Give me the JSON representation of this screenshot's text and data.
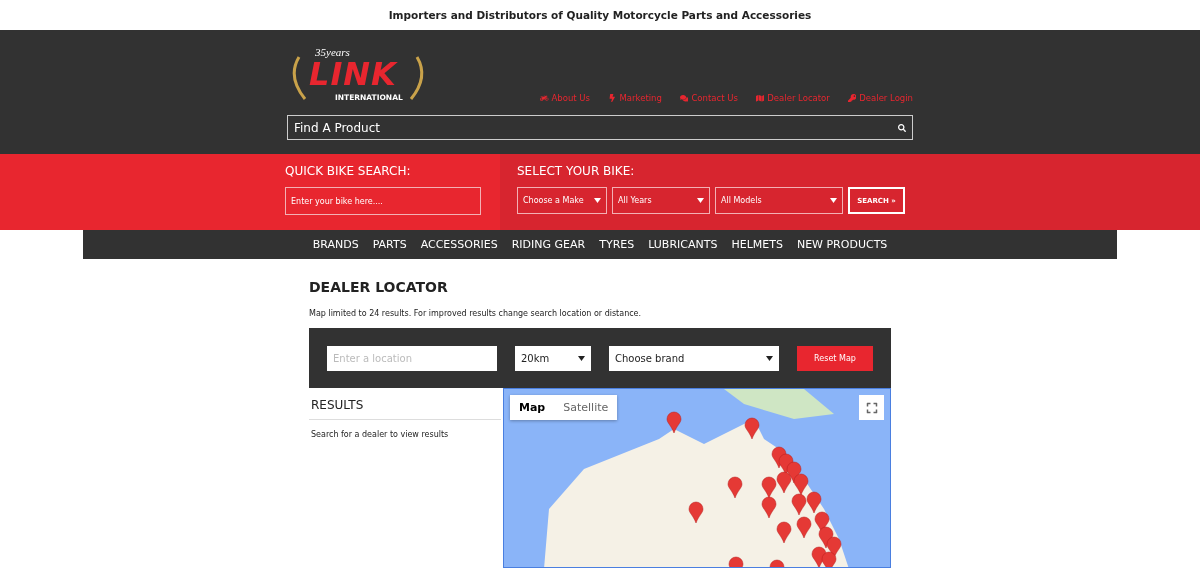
{
  "top_banner": "Importers and Distributors of Quality Motorcycle Parts and Accessories",
  "logo": {
    "years": "35years",
    "name": "LINK",
    "subtitle": "INTERNATIONAL"
  },
  "header_links": [
    "About Us",
    "Marketing",
    "Contact Us",
    "Dealer Locator",
    "Dealer Login"
  ],
  "product_search": {
    "placeholder": "Find A Product"
  },
  "quick_search": {
    "title": "QUICK BIKE SEARCH:",
    "placeholder": "Enter your bike here...."
  },
  "bike_select": {
    "title": "SELECT YOUR BIKE:",
    "selects": [
      "Choose a Make",
      "All Years",
      "All Models"
    ],
    "button": "SEARCH",
    "button_icon": "»"
  },
  "nav": [
    "BRANDS",
    "PARTS",
    "ACCESSORIES",
    "RIDING GEAR",
    "TYRES",
    "LUBRICANTS",
    "HELMETS",
    "NEW PRODUCTS"
  ],
  "page_title": "DEALER LOCATOR",
  "notice": "Map limited to 24 results. For improved results change search location or distance.",
  "filters": {
    "location_placeholder": "Enter a location",
    "distance": "20km",
    "brand": "Choose brand",
    "reset": "Reset Map"
  },
  "results": {
    "title": "RESULTS",
    "message": "Search for a dealer to view results"
  },
  "map_types": [
    {
      "label": "Map",
      "selected": true
    },
    {
      "label": "Satellite",
      "selected": false
    }
  ]
}
